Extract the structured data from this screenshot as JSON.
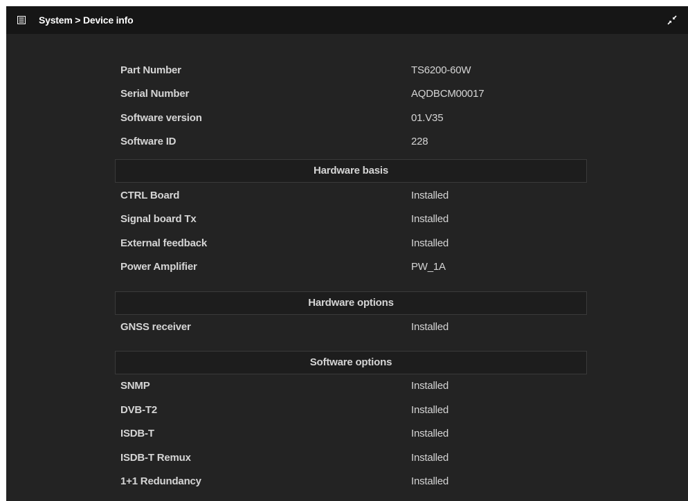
{
  "window": {
    "title": "System > Device info",
    "menu_icon": "list-icon",
    "collapse_icon": "collapse-arrows-icon"
  },
  "identity": [
    {
      "label": "Part Number",
      "value": "TS6200-60W"
    },
    {
      "label": "Serial Number",
      "value": "AQDBCM00017"
    },
    {
      "label": "Software version",
      "value": "01.V35"
    },
    {
      "label": "Software ID",
      "value": "228"
    }
  ],
  "hardware_basis": {
    "heading": "Hardware basis",
    "rows": [
      {
        "label": "CTRL Board",
        "value": "Installed"
      },
      {
        "label": "Signal board Tx",
        "value": "Installed"
      },
      {
        "label": "External feedback",
        "value": "Installed"
      },
      {
        "label": "Power Amplifier",
        "value": "PW_1A"
      }
    ]
  },
  "hardware_options": {
    "heading": "Hardware options",
    "rows": [
      {
        "label": "GNSS receiver",
        "value": "Installed"
      }
    ]
  },
  "software_options": {
    "heading": "Software options",
    "rows": [
      {
        "label": "SNMP",
        "value": "Installed"
      },
      {
        "label": "DVB-T2",
        "value": "Installed"
      },
      {
        "label": "ISDB-T",
        "value": "Installed"
      },
      {
        "label": "ISDB-T Remux",
        "value": "Installed"
      },
      {
        "label": "1+1 Redundancy",
        "value": "Installed"
      }
    ]
  }
}
